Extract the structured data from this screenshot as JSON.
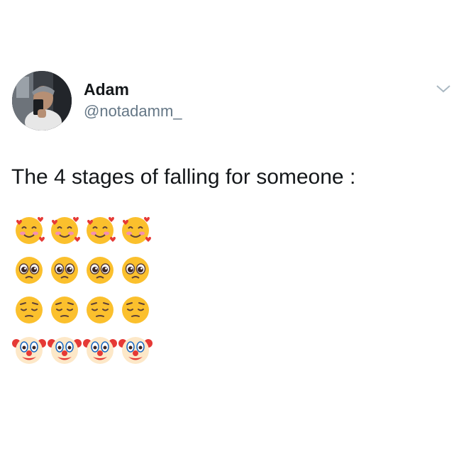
{
  "tweet": {
    "author": {
      "display_name": "Adam",
      "handle": "@notadamm_"
    },
    "text": "The 4 stages of falling for someone :",
    "menu_icon": "chevron-down-icon",
    "emoji_rows": [
      {
        "name": "smiling-face-with-hearts",
        "count": 4
      },
      {
        "name": "pleading-face",
        "count": 4
      },
      {
        "name": "pensive-face",
        "count": 4
      },
      {
        "name": "clown-face",
        "count": 4
      }
    ]
  },
  "colors": {
    "text_primary": "#14171a",
    "text_secondary": "#657786",
    "background": "#ffffff",
    "emoji_yellow": "#fbc02d",
    "heart_red": "#e53935"
  }
}
